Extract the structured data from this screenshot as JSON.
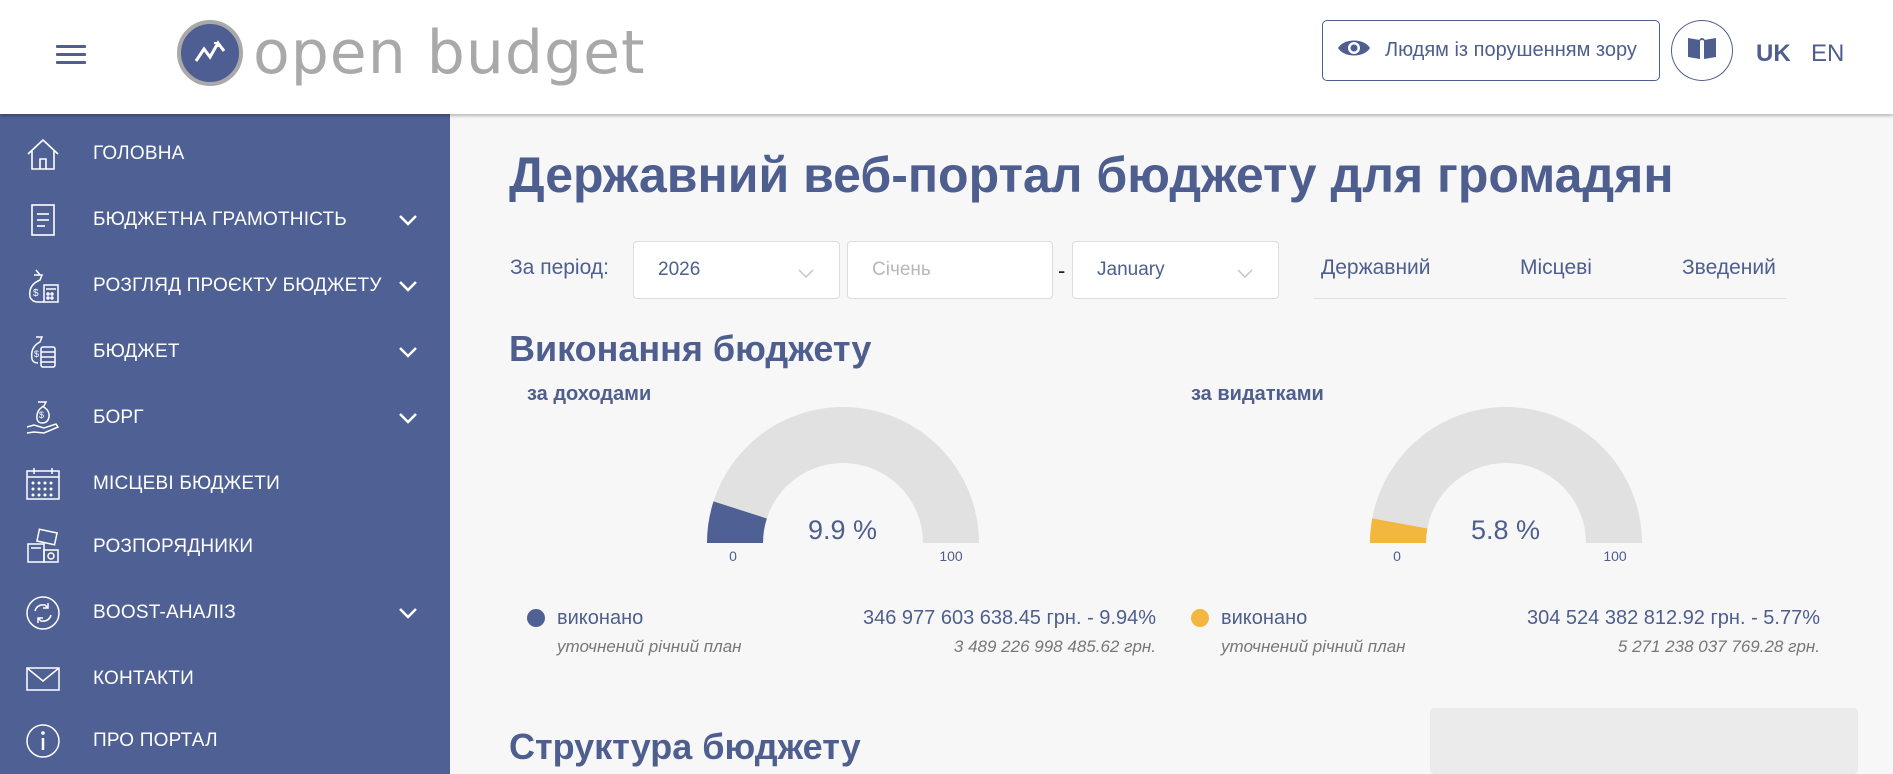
{
  "header": {
    "logo_text": "open budget",
    "vision_button_label": "Людям із порушенням зору",
    "lang_uk": "UK",
    "lang_en": "EN"
  },
  "sidebar": {
    "items": [
      {
        "label": "ГОЛОВНА",
        "icon": "home-icon",
        "has_submenu": false
      },
      {
        "label": "БЮДЖЕТНА ГРАМОТНІСТЬ",
        "icon": "document-icon",
        "has_submenu": true
      },
      {
        "label": "РОЗГЛЯД ПРОЄКТУ БЮДЖЕТУ",
        "icon": "money-bag-calculator-icon",
        "has_submenu": true
      },
      {
        "label": "БЮДЖЕТ",
        "icon": "money-bag-coins-icon",
        "has_submenu": true
      },
      {
        "label": "БОРГ",
        "icon": "hand-money-icon",
        "has_submenu": true
      },
      {
        "label": "МІСЦЕВІ БЮДЖЕТИ",
        "icon": "calendar-icon",
        "has_submenu": false
      },
      {
        "label": "РОЗПОРЯДНИКИ",
        "icon": "cash-register-icon",
        "has_submenu": false
      },
      {
        "label": "BOOST-АНАЛІЗ",
        "icon": "refresh-circle-icon",
        "has_submenu": true
      },
      {
        "label": "КОНТАКТИ",
        "icon": "envelope-icon",
        "has_submenu": false
      },
      {
        "label": "ПРО ПОРТАЛ",
        "icon": "info-icon",
        "has_submenu": false
      }
    ]
  },
  "main": {
    "title": "Державний веб-портал бюджету для громадян",
    "period_label": "За період:",
    "year_value": "2026",
    "month_from_placeholder": "Січень",
    "dash": "-",
    "month_to_value": "January",
    "budget_types": [
      "Державний",
      "Місцеві",
      "Зведений"
    ],
    "execution_title": "Виконання бюджету",
    "structure_title": "Структура бюджету",
    "income": {
      "subtitle": "за доходами",
      "percent_text": "9.9 %",
      "percent": 9.9,
      "gauge_min": "0",
      "gauge_max": "100",
      "color": "#4f6094",
      "legend_label": "виконано",
      "legend_value": "346 977 603 638.45 грн. - 9.94%",
      "plan_label": "уточнений річний план",
      "plan_value": "3 489 226 998 485.62 грн."
    },
    "expense": {
      "subtitle": "за видатками",
      "percent_text": "5.8 %",
      "percent": 5.8,
      "gauge_min": "0",
      "gauge_max": "100",
      "color": "#f3b63f",
      "legend_label": "виконано",
      "legend_value": "304 524 382 812.92 грн. - 5.77%",
      "plan_label": "уточнений річний план",
      "plan_value": "5 271 238 037 769.28 грн."
    }
  },
  "colors": {
    "primary": "#4f6094",
    "accent_yellow": "#f3b63f",
    "gauge_track": "#e1e1e1",
    "background": "#f7f7f7"
  }
}
